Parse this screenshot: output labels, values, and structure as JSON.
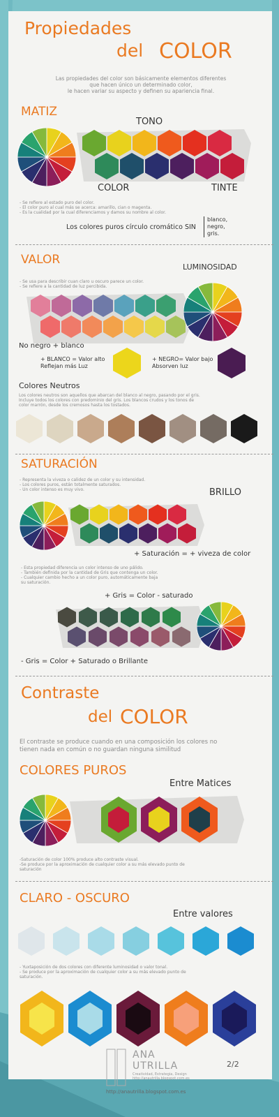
{
  "header": {
    "title_line1": "Propiedades",
    "title_line2_prefix": "del",
    "title_line2_main": "COLOR",
    "intro": [
      "Las propiedades del color son básicamente elementos diferentes",
      "que hacen único un determinado color,",
      "le hacen variar su aspecto y definen su apariencia final."
    ]
  },
  "matiz": {
    "title": "MATIZ",
    "tono": "TONO",
    "color": "COLOR",
    "tinte": "TINTE",
    "notes": [
      "- Se refiere al estado puro del color.",
      "- El color puro al cual más se acerca: amarillo, cian o magenta.",
      "- Es la cualidad por la cual diferenciamos y damos su nombre al color."
    ],
    "puros": "Los colores puros círculo cromático SIN",
    "brace": [
      "blanco,",
      "negro,",
      "gris."
    ]
  },
  "valor": {
    "title": "VALOR",
    "luminosidad": "LUMINOSIDAD",
    "notes": [
      "- Se usa para describir cuan claro u oscuro parece un color.",
      "- Se refiere a la cantidad de luz percibida."
    ],
    "no_negro": "No negro + blanco",
    "mas_blanco": [
      "+ BLANCO = Valor alto",
      "Reflejan más Luz"
    ],
    "mas_negro": [
      "+ NEGRO= Valor bajo",
      "Absorven luz"
    ],
    "neutros_title": "Colores Neutros",
    "neutros_text": [
      "Los colores neutros son aquellos que abarcan del blanco al negro, pasando por el gris.",
      "Incluye todos los colores con predominio del gris. Los blancos crudos y los tonos de",
      "color marrón, desde los cremosos hasta los tostados."
    ]
  },
  "saturacion": {
    "title": "SATURACIÓN",
    "notes": [
      "- Representa la viveza o calidez de un color y su intensidad.",
      "- Los colores puros, están totalmente saturados.",
      "- Un color intenso es muy vivo."
    ],
    "brillo": "BRILLO",
    "mas_sat": "+ Saturación = + viveza de color",
    "notes2": [
      "- Esta propiedad diferencia un color intenso de uno pálido.",
      "- También definida por la cantidad de Gris que contenga un color.",
      "- Cualquier cambio hecho a un color puro, automáticamente baja",
      "  su saturación."
    ],
    "mas_gris": "+ Gris = Color - saturado",
    "menos_gris": "- Gris = Color + Saturado o Brillante"
  },
  "contraste": {
    "title_line1": "Contraste",
    "title_line2_prefix": "del",
    "title_line2_main": "COLOR",
    "intro": [
      "El contraste se produce cuando en una composición los colores no",
      "tienen nada en común o no guardan ninguna similitud"
    ]
  },
  "puros": {
    "title": "COLORES PUROS",
    "subtitle": "Entre Matices",
    "notes": [
      "-Saturación de color 100% produce alto contraste visual.",
      "-Se produce por la aproximación de cualquier color a su más elevado punto de",
      "saturación"
    ]
  },
  "claro": {
    "title": "CLARO - OSCURO",
    "subtitle": "Entre valores",
    "notes": [
      "- Yuxtaposición de dos colores con diferente luminosidad o valor tonal.",
      "- Se produce por la aproximación de cualquier color a su más elevado punto de",
      "saturación."
    ]
  },
  "footer": {
    "page": "2/2",
    "brand_line1": "ANA",
    "brand_line2": "UTRILLA",
    "brand_sub1": "Creatividad, Estrategia, Design",
    "brand_sub2": "http://anautrilla.blogspot.com.es",
    "url": "http://anautrilla.blogspot.com.es"
  },
  "colors": {
    "accent": "#ea7a22",
    "teal": "#6fb9c1",
    "background": "#f4f4f2"
  }
}
